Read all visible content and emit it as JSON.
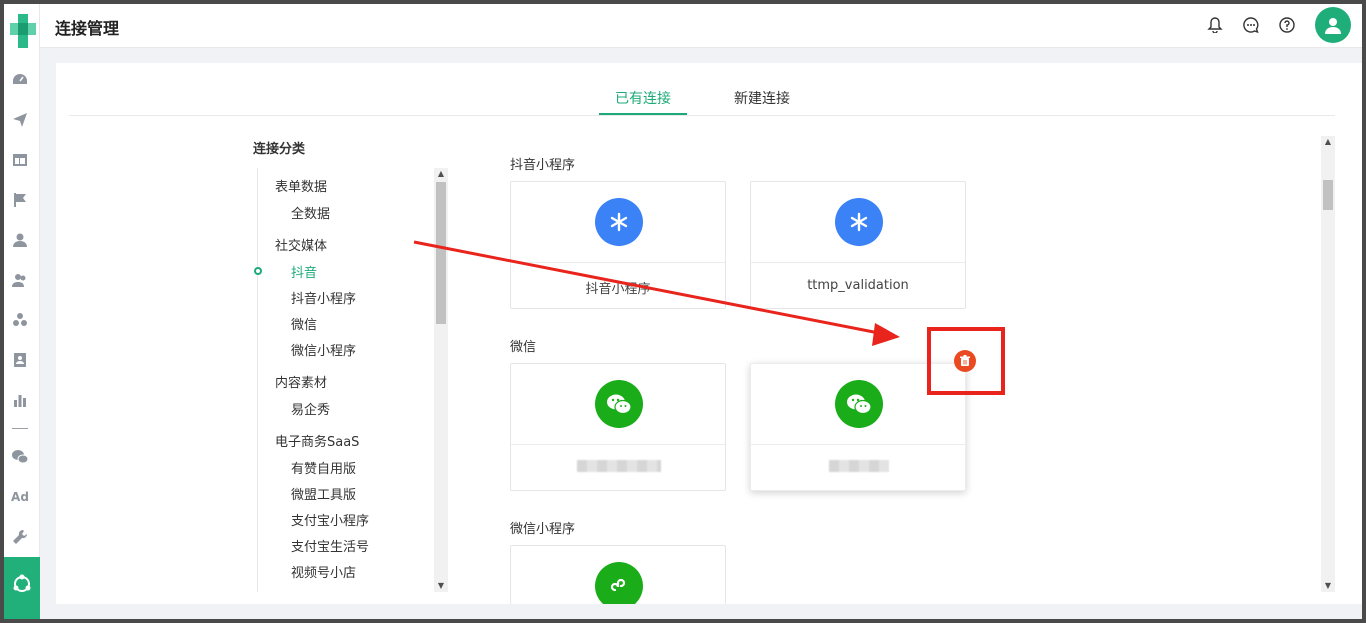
{
  "header": {
    "title": "连接管理"
  },
  "tabs": [
    {
      "label": "已有连接",
      "active": true
    },
    {
      "label": "新建连接",
      "active": false
    }
  ],
  "categories": {
    "title": "连接分类",
    "items": [
      {
        "label": "表单数据",
        "level": "group"
      },
      {
        "label": "全数据",
        "level": "child"
      },
      {
        "label": "社交媒体",
        "level": "group"
      },
      {
        "label": "抖音",
        "level": "child",
        "active": true
      },
      {
        "label": "抖音小程序",
        "level": "child"
      },
      {
        "label": "微信",
        "level": "child"
      },
      {
        "label": "微信小程序",
        "level": "child"
      },
      {
        "label": "内容素材",
        "level": "group"
      },
      {
        "label": "易企秀",
        "level": "child"
      },
      {
        "label": "电子商务SaaS",
        "level": "group"
      },
      {
        "label": "有赞自用版",
        "level": "child"
      },
      {
        "label": "微盟工具版",
        "level": "child"
      },
      {
        "label": "支付宝小程序",
        "level": "child"
      },
      {
        "label": "支付宝生活号",
        "level": "child"
      },
      {
        "label": "视频号小店",
        "level": "child"
      }
    ]
  },
  "sections": [
    {
      "title": "抖音小程序",
      "cards": [
        {
          "name": "抖音小程序",
          "icon": "tiktok-miniapp-icon",
          "color": "#3b82f6"
        },
        {
          "name": "ttmp_validation",
          "icon": "tiktok-miniapp-icon",
          "color": "#3b82f6"
        }
      ]
    },
    {
      "title": "微信",
      "cards": [
        {
          "name": "",
          "icon": "wechat-icon",
          "color": "#1aad19",
          "redacted": true
        },
        {
          "name": "",
          "icon": "wechat-icon",
          "color": "#1aad19",
          "redacted": true
        }
      ]
    },
    {
      "title": "微信小程序",
      "cards": [
        {
          "name": "",
          "icon": "wechat-miniprogram-icon",
          "color": "#1aad19"
        }
      ]
    }
  ],
  "colors": {
    "accent": "#1cab78",
    "annotation": "#e8241c",
    "delete": "#ea4a22"
  }
}
